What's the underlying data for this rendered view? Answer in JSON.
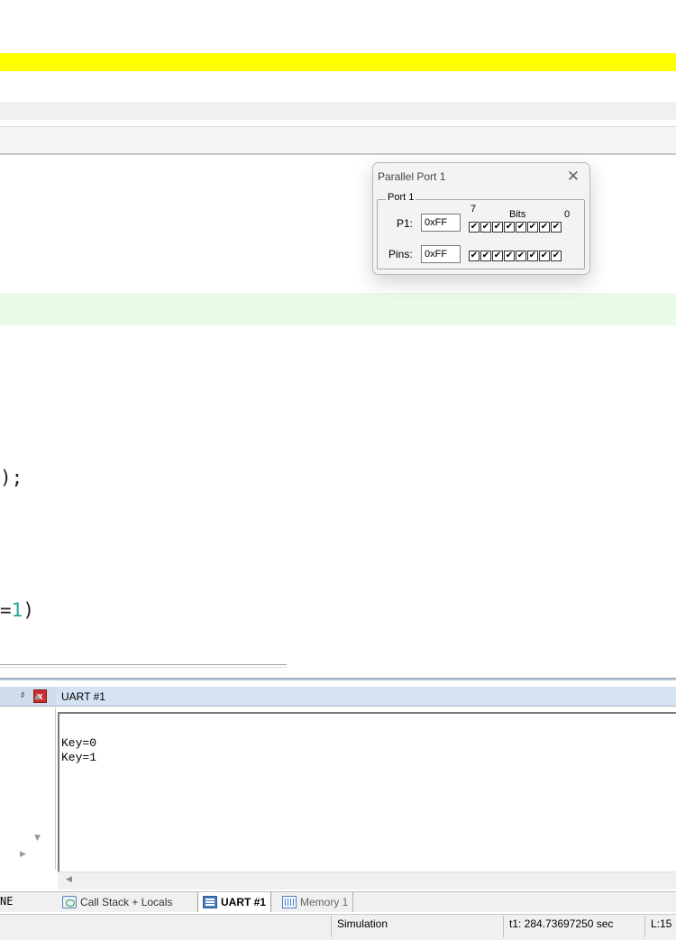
{
  "editor": {
    "code_line_a": ");",
    "code_line_b_prefix": "=",
    "code_line_b_number": "1",
    "code_line_b_suffix": ")"
  },
  "parallel_port": {
    "title": "Parallel Port 1",
    "close_glyph": "✕",
    "group_label": "Port 1",
    "bit_high_label": "7",
    "bits_label": "Bits",
    "bit_low_label": "0",
    "p1_label": "P1:",
    "p1_value": "0xFF",
    "pins_label": "Pins:",
    "pins_value": "0xFF",
    "checkmark": "✔"
  },
  "left_panel": {
    "pin_glyph": "♯",
    "close_glyph": "x",
    "up_arrow": "▲",
    "down_arrow": "▼",
    "right_arrow": "▶",
    "tab_label": "NE"
  },
  "uart": {
    "title": "UART #1",
    "lines": [
      "Key=0",
      "Key=1"
    ],
    "left_arrow": "◀"
  },
  "tabs": [
    {
      "label": "Call Stack + Locals",
      "icon": "call-stack-icon"
    },
    {
      "label": "UART #1",
      "icon": "uart-icon"
    },
    {
      "label": "Memory 1",
      "icon": "memory-icon"
    }
  ],
  "status": {
    "mode": "Simulation",
    "time": "t1: 284.73697250 sec",
    "line": "L:15"
  }
}
